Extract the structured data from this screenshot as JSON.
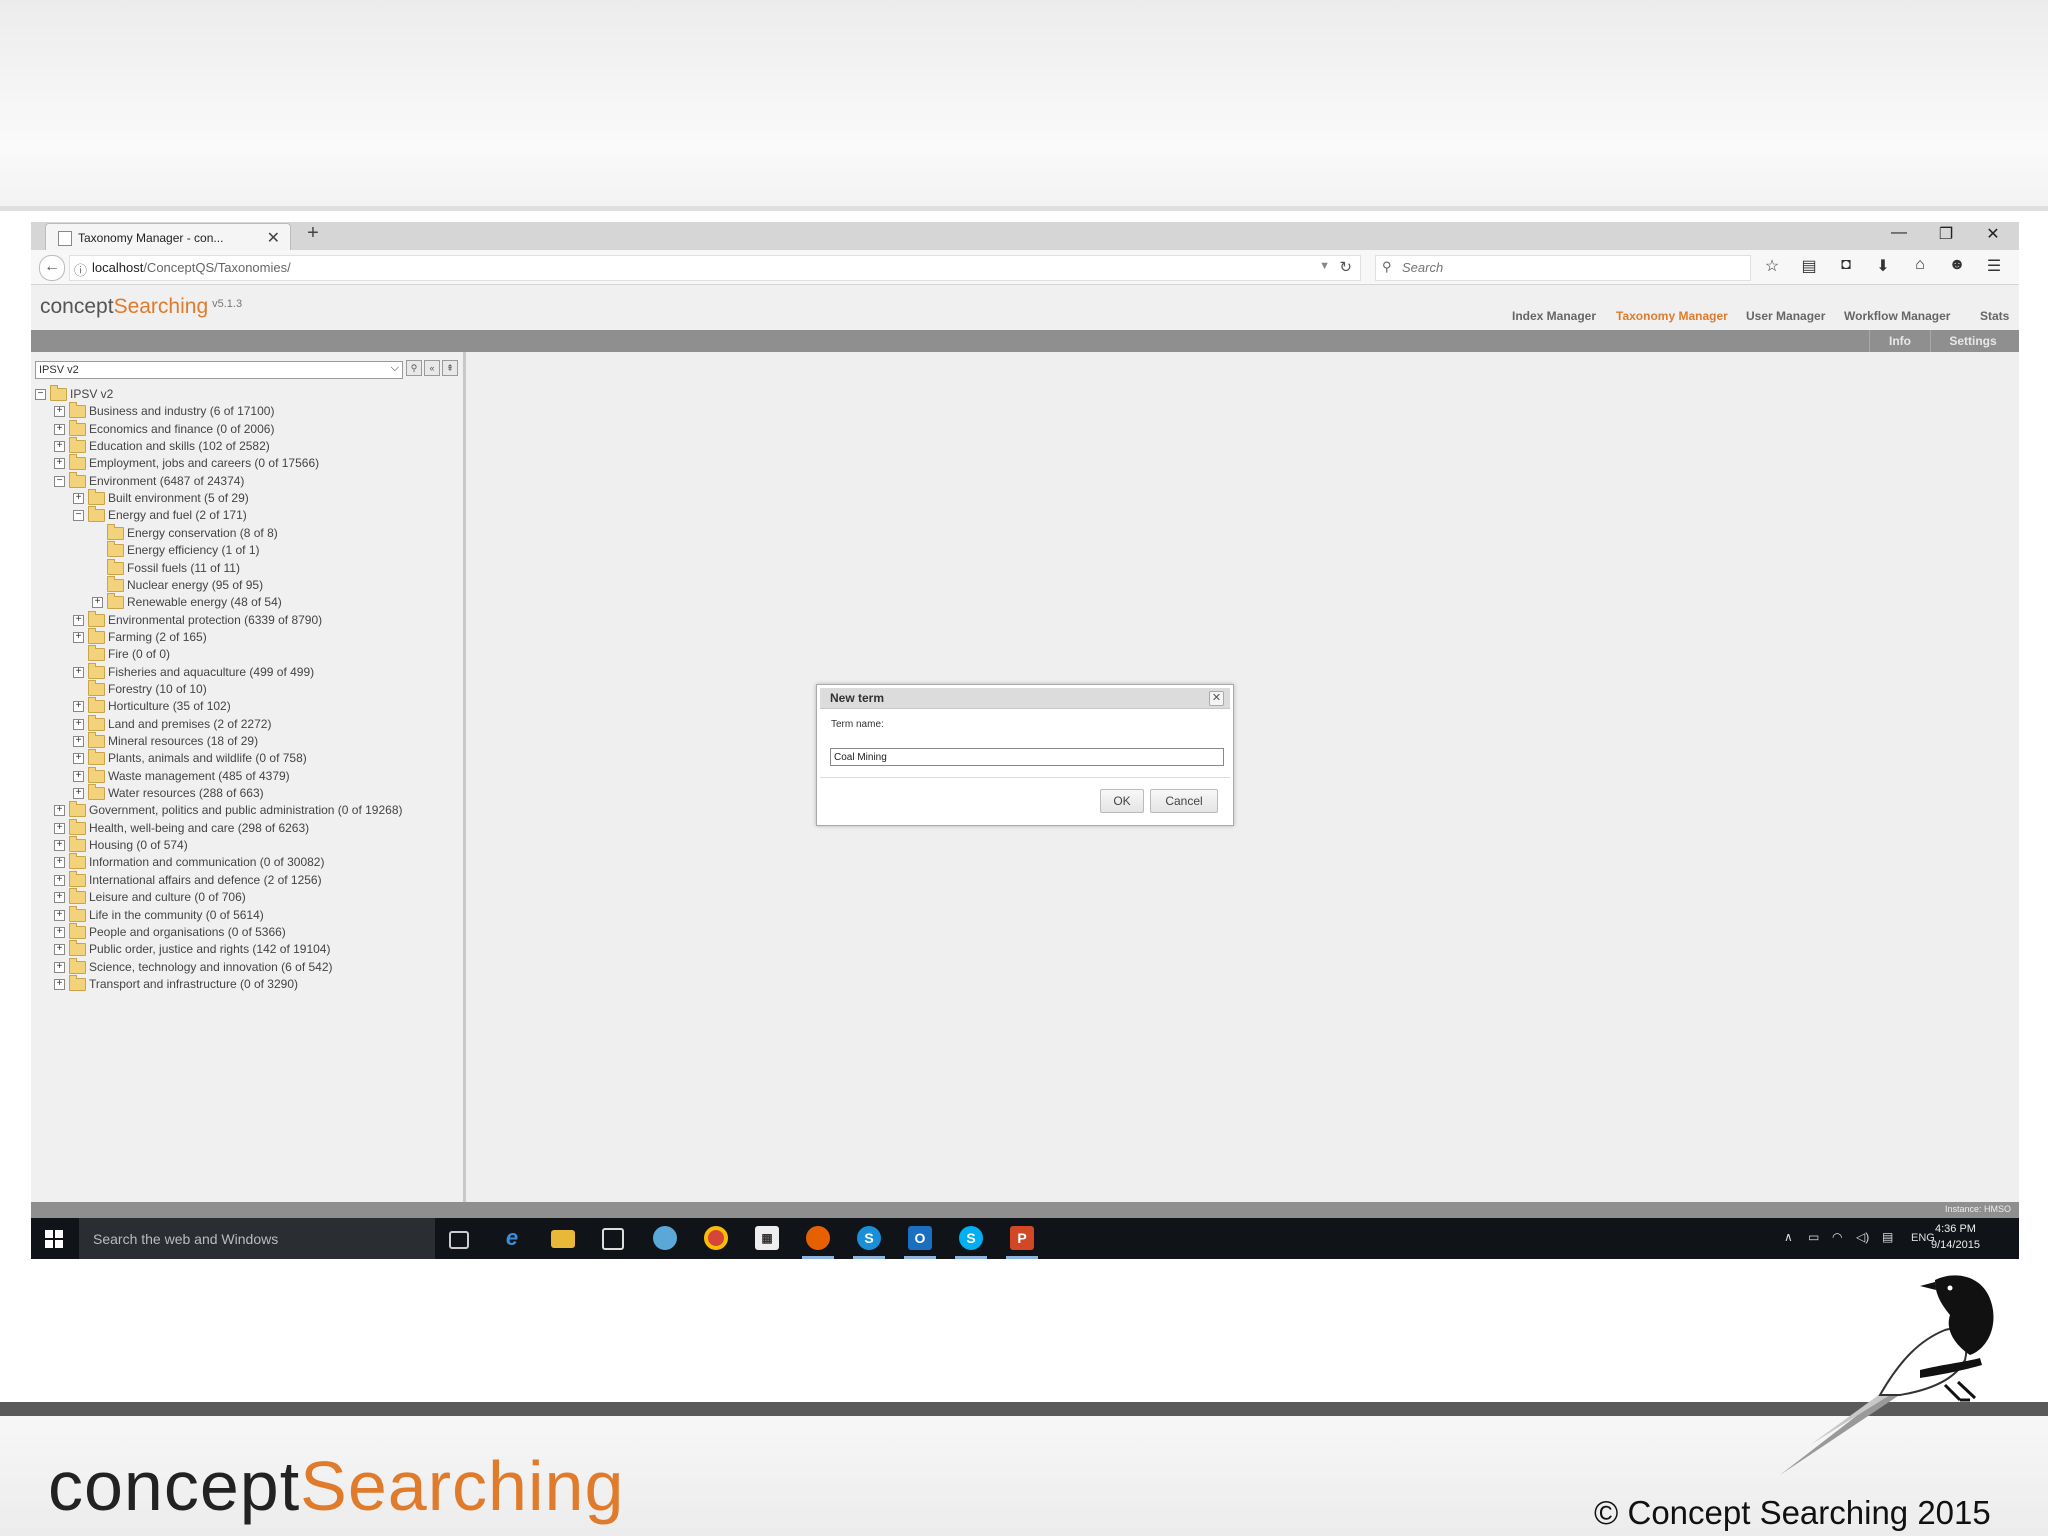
{
  "slide": {
    "logo_part1": "concept",
    "logo_part2": "Searching",
    "copyright": "© Concept Searching 2015"
  },
  "browser": {
    "tab_title": "Taxonomy Manager - con...",
    "url_host": "localhost",
    "url_path": "/ConceptQS/Taxonomies/",
    "search_placeholder": "Search"
  },
  "app": {
    "brand_part1": "concept",
    "brand_part2": "Searching",
    "version": "v5.1.3",
    "nav": [
      "Index Manager",
      "Taxonomy Manager",
      "User Manager",
      "Workflow Manager",
      "Stats"
    ],
    "active_nav": "Taxonomy Manager",
    "subnav": [
      "Info",
      "Settings"
    ],
    "instance": "Instance: HMSO"
  },
  "taxonomy": {
    "selected": "IPSV v2",
    "nodes": [
      {
        "label": "IPSV v2",
        "level": 0,
        "expander": "−"
      },
      {
        "label": "Business and industry (6 of 17100)",
        "level": 1,
        "expander": "+"
      },
      {
        "label": "Economics and finance (0 of 2006)",
        "level": 1,
        "expander": "+"
      },
      {
        "label": "Education and skills (102 of 2582)",
        "level": 1,
        "expander": "+"
      },
      {
        "label": "Employment, jobs and careers (0 of 17566)",
        "level": 1,
        "expander": "+"
      },
      {
        "label": "Environment (6487 of 24374)",
        "level": 1,
        "expander": "−"
      },
      {
        "label": "Built environment (5 of 29)",
        "level": 2,
        "expander": "+"
      },
      {
        "label": "Energy and fuel (2 of 171)",
        "level": 2,
        "expander": "−"
      },
      {
        "label": "Energy conservation (8 of 8)",
        "level": 3,
        "expander": ""
      },
      {
        "label": "Energy efficiency (1 of 1)",
        "level": 3,
        "expander": ""
      },
      {
        "label": "Fossil fuels (11 of 11)",
        "level": 3,
        "expander": ""
      },
      {
        "label": "Nuclear energy (95 of 95)",
        "level": 3,
        "expander": ""
      },
      {
        "label": "Renewable energy (48 of 54)",
        "level": 3,
        "expander": "+"
      },
      {
        "label": "Environmental protection (6339 of 8790)",
        "level": 2,
        "expander": "+"
      },
      {
        "label": "Farming (2 of 165)",
        "level": 2,
        "expander": "+"
      },
      {
        "label": "Fire (0 of 0)",
        "level": 2,
        "expander": ""
      },
      {
        "label": "Fisheries and aquaculture (499 of 499)",
        "level": 2,
        "expander": "+"
      },
      {
        "label": "Forestry (10 of 10)",
        "level": 2,
        "expander": ""
      },
      {
        "label": "Horticulture (35 of 102)",
        "level": 2,
        "expander": "+"
      },
      {
        "label": "Land and premises (2 of 2272)",
        "level": 2,
        "expander": "+"
      },
      {
        "label": "Mineral resources (18 of 29)",
        "level": 2,
        "expander": "+"
      },
      {
        "label": "Plants, animals and wildlife (0 of 758)",
        "level": 2,
        "expander": "+"
      },
      {
        "label": "Waste management (485 of 4379)",
        "level": 2,
        "expander": "+"
      },
      {
        "label": "Water resources (288 of 663)",
        "level": 2,
        "expander": "+"
      },
      {
        "label": "Government, politics and public administration (0 of 19268)",
        "level": 1,
        "expander": "+"
      },
      {
        "label": "Health, well-being and care (298 of 6263)",
        "level": 1,
        "expander": "+"
      },
      {
        "label": "Housing (0 of 574)",
        "level": 1,
        "expander": "+"
      },
      {
        "label": "Information and communication (0 of 30082)",
        "level": 1,
        "expander": "+"
      },
      {
        "label": "International affairs and defence (2 of 1256)",
        "level": 1,
        "expander": "+"
      },
      {
        "label": "Leisure and culture (0 of 706)",
        "level": 1,
        "expander": "+"
      },
      {
        "label": "Life in the community (0 of 5614)",
        "level": 1,
        "expander": "+"
      },
      {
        "label": "People and organisations (0 of 5366)",
        "level": 1,
        "expander": "+"
      },
      {
        "label": "Public order, justice and rights (142 of 19104)",
        "level": 1,
        "expander": "+"
      },
      {
        "label": "Science, technology and innovation (6 of 542)",
        "level": 1,
        "expander": "+"
      },
      {
        "label": "Transport and infrastructure (0 of 3290)",
        "level": 1,
        "expander": "+"
      }
    ]
  },
  "dialog": {
    "title": "New term",
    "field_label": "Term name:",
    "field_value": "Coal Mining",
    "ok": "OK",
    "cancel": "Cancel"
  },
  "taskbar": {
    "search_placeholder": "Search the web and Windows",
    "apps": [
      "task-view",
      "edge",
      "file-explorer",
      "store",
      "ie",
      "chrome",
      "calculator",
      "firefox",
      "skype-business",
      "outlook",
      "skype",
      "powerpoint"
    ],
    "language": "ENG",
    "time": "4:36 PM",
    "date": "9/14/2015"
  }
}
